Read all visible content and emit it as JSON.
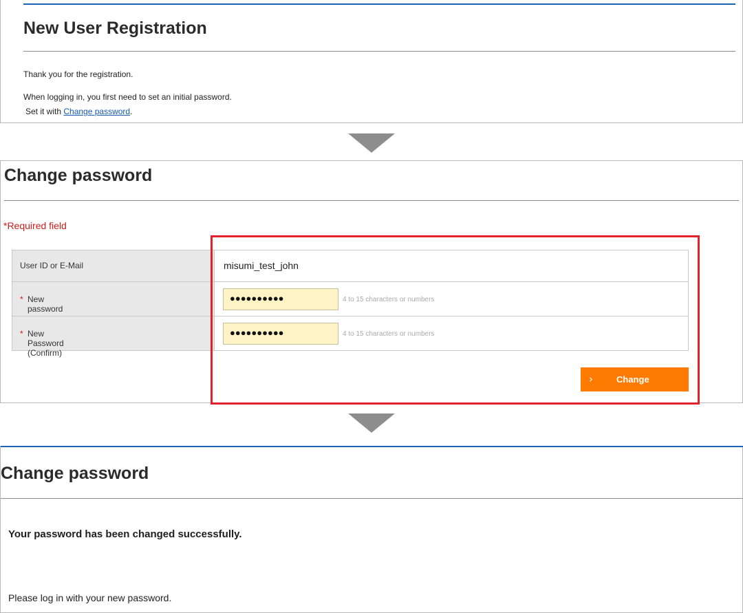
{
  "registration": {
    "title": "New User Registration",
    "line1": "Thank you for the registration.",
    "line2": "When logging in, you first need to set an initial password.",
    "line3_prefix": "Set it with ",
    "line3_link": "Change password",
    "line3_suffix": "."
  },
  "change_form": {
    "title": "Change password",
    "required_note": "*Required field",
    "rows": [
      {
        "label": "User ID or E-Mail",
        "value": "misumi_test_john"
      },
      {
        "label": "New password",
        "required_mark": "*",
        "masked": "●●●●●●●●●●",
        "hint": "4 to 15 characters or numbers"
      },
      {
        "label": "New Password (Confirm)",
        "required_mark": "*",
        "masked": "●●●●●●●●●●",
        "hint": "4 to 15 characters or numbers"
      }
    ],
    "button_label": "Change",
    "button_icon": "chevron-right-icon"
  },
  "result": {
    "title": "Change password",
    "success_message": "Your password has been changed successfully.",
    "login_note": "Please log in with your new password."
  },
  "colors": {
    "accent_blue": "#1a63b8",
    "required_red": "#d11a1a",
    "button_orange": "#ff7a00",
    "highlight_red": "#e2222a",
    "field_yellow": "#fdf3c4"
  }
}
